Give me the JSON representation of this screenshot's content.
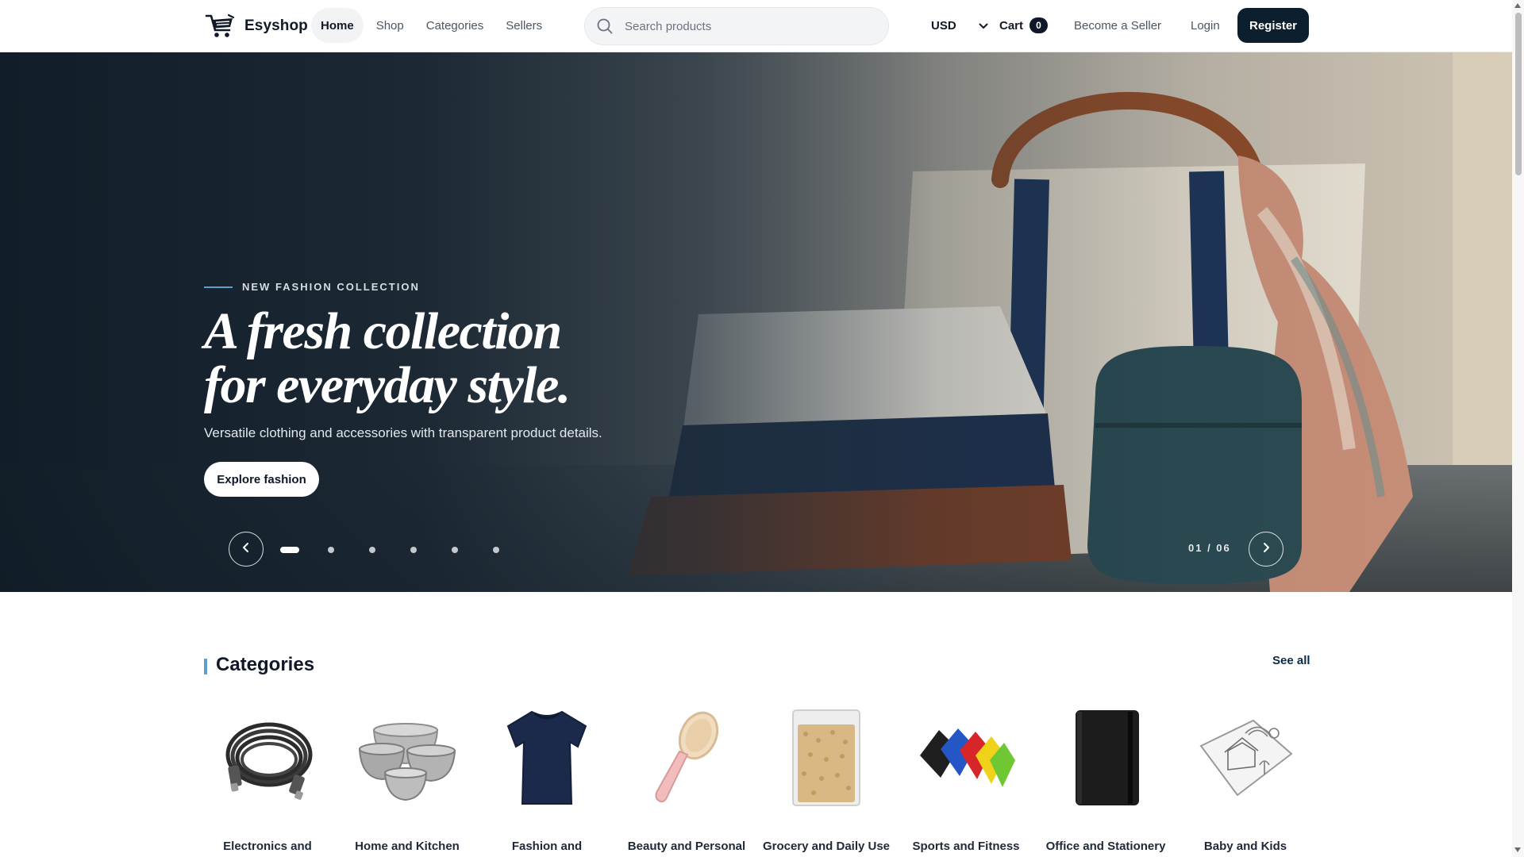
{
  "brand": {
    "name": "Esyshop",
    "icon": "shopping-cart-icon"
  },
  "nav": {
    "items": [
      {
        "label": "Home",
        "active": true
      },
      {
        "label": "Shop",
        "active": false
      },
      {
        "label": "Categories",
        "active": false
      },
      {
        "label": "Sellers",
        "active": false
      }
    ]
  },
  "search": {
    "placeholder": "Search products",
    "value": "",
    "icon": "search-icon"
  },
  "currency": {
    "selected": "USD",
    "icon": "chevron-down-icon"
  },
  "cart": {
    "label": "Cart",
    "count": "0"
  },
  "header_links": {
    "become_seller": "Become a Seller",
    "login": "Login",
    "register": "Register"
  },
  "hero": {
    "eyebrow": "NEW FASHION COLLECTION",
    "headline_line1": "A fresh collection",
    "headline_line2": "for everyday style.",
    "subline": "Versatile clothing and accessories with transparent product details.",
    "cta_label": "Explore fashion",
    "slide_counter": "01 / 06",
    "active_slide": 1,
    "total_slides": 6,
    "prev_icon": "chevron-left-icon",
    "next_icon": "chevron-right-icon"
  },
  "categories": {
    "title": "Categories",
    "see_all": "See all",
    "items": [
      {
        "label": "Electronics and",
        "icon": "cable-icon"
      },
      {
        "label": "Home and Kitchen",
        "icon": "bowls-icon"
      },
      {
        "label": "Fashion and",
        "icon": "tshirt-icon"
      },
      {
        "label": "Beauty and Personal",
        "icon": "hairbrush-icon"
      },
      {
        "label": "Grocery and Daily Use",
        "icon": "grain-bag-icon"
      },
      {
        "label": "Sports and Fitness",
        "icon": "resistance-bands-icon"
      },
      {
        "label": "Office and Stationery",
        "icon": "notebook-icon"
      },
      {
        "label": "Baby and Kids",
        "icon": "coloring-mat-icon"
      }
    ]
  },
  "colors": {
    "brand_dark": "#0c1f2e",
    "accent_blue": "#5aa0c8",
    "hero_overlay": "#16232f"
  }
}
